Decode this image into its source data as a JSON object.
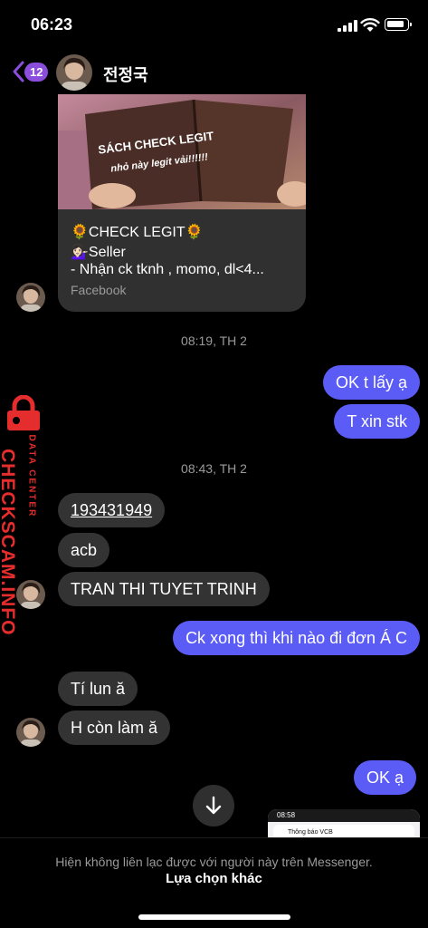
{
  "status_bar": {
    "time": "06:23"
  },
  "header": {
    "unread_count": "12",
    "contact_name": "전정국"
  },
  "link_card": {
    "image_text_line1": "SÁCH CHECK LEGIT",
    "image_text_line2": "nhỏ này legit vải!!!!!!",
    "title": "🌻CHECK LEGIT🌻",
    "line2": "💁🏻‍♀️Seller",
    "line3": "- Nhận ck tknh , momo, dl<4...",
    "source": "Facebook"
  },
  "timestamps": [
    "08:19, TH 2",
    "08:43, TH 2"
  ],
  "messages": [
    {
      "text": "OK t lấy ạ",
      "direction": "outgoing"
    },
    {
      "text": "T xin stk",
      "direction": "outgoing"
    },
    {
      "text": "193431949",
      "direction": "incoming"
    },
    {
      "text": "acb",
      "direction": "incoming"
    },
    {
      "text": "TRAN THI TUYET TRINH",
      "direction": "incoming"
    },
    {
      "text": "Ck xong thì khi nào đi đơn Á C",
      "direction": "outgoing"
    },
    {
      "text": "Tí lun ă",
      "direction": "incoming"
    },
    {
      "text": "H còn làm ă",
      "direction": "incoming"
    },
    {
      "text": "OK ạ",
      "direction": "outgoing"
    }
  ],
  "watermark": {
    "brand": "CHECKSCAM.INFO",
    "subtitle": "DATA CENTER"
  },
  "attachment_preview": {
    "time": "08:58",
    "notice": "Thông báo VCB"
  },
  "footer": {
    "notice": "Hiện không liên lạc được với người này trên Messenger.",
    "option": "Lựa chọn khác"
  },
  "colors": {
    "outgoing_bubble": "#5b5cf6",
    "incoming_bubble": "#333333",
    "badge": "#8b4ddb",
    "watermark_red": "#e52d2d"
  },
  "icons": [
    "back-chevron-icon",
    "scroll-down-arrow-icon",
    "lock-icon",
    "signal-icon",
    "wifi-icon",
    "battery-icon"
  ]
}
